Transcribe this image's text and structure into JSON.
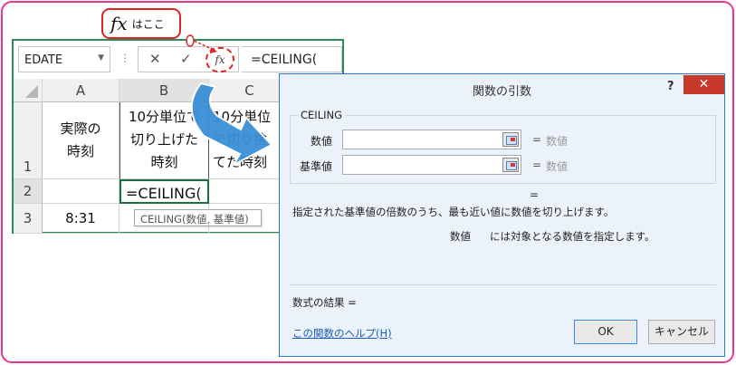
{
  "callout": {
    "fx_symbol": "fx",
    "text": "はここ"
  },
  "excel": {
    "name_box": "EDATE",
    "cancel_glyph": "✕",
    "enter_glyph": "✓",
    "fx_symbol": "fx",
    "formula": "=CEILING(",
    "columns": [
      "A",
      "B",
      "C"
    ],
    "rows": [
      "1",
      "2",
      "3"
    ],
    "cells": {
      "a1": "実際の\n時刻",
      "b1": "10分単位で\n切り上げた\n時刻",
      "c1": "10分単位\nで切り捨\nてた時刻",
      "b2": "=CEILING(",
      "a3": "8:31"
    },
    "tooltip": "CEILING(数値, 基準値)"
  },
  "dialog": {
    "title": "関数の引数",
    "help": "?",
    "close": "✕",
    "function_name": "CEILING",
    "args": [
      {
        "label": "数値",
        "value": "",
        "eq": "=",
        "hint": "数値"
      },
      {
        "label": "基準値",
        "value": "",
        "eq": "=",
        "hint": "数値"
      }
    ],
    "result_eq": "=",
    "description": "指定された基準値の倍数のうち、最も近い値に数値を切り上げます。",
    "arg_desc_name": "数値",
    "arg_desc_text": "には対象となる数値を指定します。",
    "formula_result": "数式の結果 =",
    "help_link": "この関数のヘルプ(H)",
    "ok": "OK",
    "cancel": "キャンセル"
  },
  "colors": {
    "frame": "#e8368f",
    "callout": "#e02424",
    "excel_border": "#2e8b57",
    "arrow": "#3a8fd6",
    "dialog_bg": "#ebf2fb",
    "close_bg": "#c7392b",
    "link": "#1a5fb4"
  }
}
